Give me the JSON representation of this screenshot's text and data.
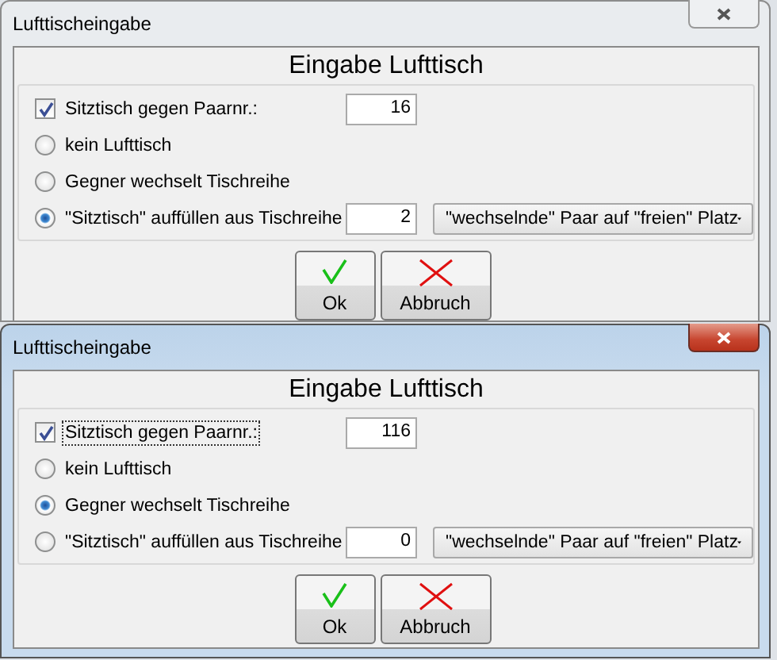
{
  "dialogs": [
    {
      "title": "Lufttischeingabe",
      "active": false,
      "heading": "Eingabe Lufttisch",
      "checkbox": {
        "label": "Sitztisch gegen Paarnr.:",
        "checked": true,
        "focused": false,
        "value": "16"
      },
      "options": [
        {
          "label": "kein Lufttisch",
          "selected": false
        },
        {
          "label": "Gegner wechselt Tischreihe",
          "selected": false
        },
        {
          "label": "\"Sitztisch\" auffüllen aus Tischreihe",
          "selected": true,
          "field": "2",
          "dropdown": "\"wechselnde\" Paar auf \"freien\" Platz"
        }
      ],
      "buttons": [
        {
          "label": "Ok",
          "kind": "ok"
        },
        {
          "label": "Abbruch",
          "kind": "cancel"
        }
      ]
    },
    {
      "title": "Lufttischeingabe",
      "active": true,
      "heading": "Eingabe Lufttisch",
      "checkbox": {
        "label": "Sitztisch gegen Paarnr.:",
        "checked": true,
        "focused": true,
        "value": "116"
      },
      "options": [
        {
          "label": "kein Lufttisch",
          "selected": false
        },
        {
          "label": "Gegner wechselt Tischreihe",
          "selected": true
        },
        {
          "label": "\"Sitztisch\" auffüllen aus Tischreihe",
          "selected": false,
          "field": "0",
          "dropdown": "\"wechselnde\" Paar auf \"freien\" Platz"
        }
      ],
      "buttons": [
        {
          "label": "Ok",
          "kind": "ok"
        },
        {
          "label": "Abbruch",
          "kind": "cancel"
        }
      ]
    }
  ]
}
